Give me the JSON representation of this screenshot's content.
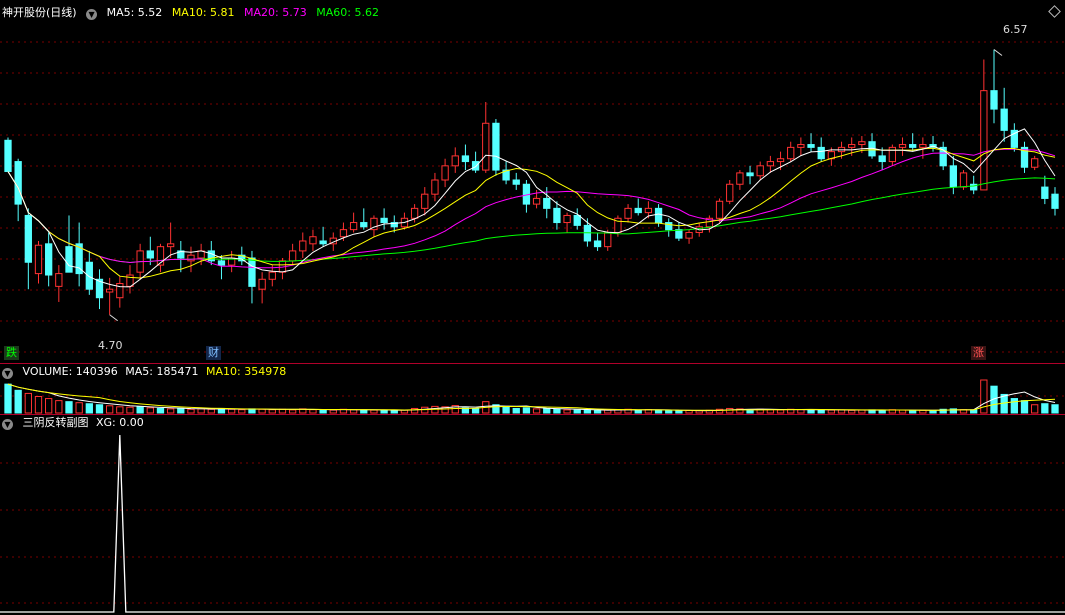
{
  "header": {
    "stock_name": "神开股份(日线)",
    "ma": [
      {
        "label": "MA5: 5.52",
        "color": "#ffffff"
      },
      {
        "label": "MA10: 5.81",
        "color": "#ffff00"
      },
      {
        "label": "MA20: 5.73",
        "color": "#ff00ff"
      },
      {
        "label": "MA60: 5.62",
        "color": "#00ff00"
      }
    ]
  },
  "price_pane": {
    "high_label": "6.57",
    "low_label": "4.70",
    "markers": [
      {
        "text": "跌",
        "color": "#00ff00"
      },
      {
        "text": "财",
        "color": "#4aa8ff"
      },
      {
        "text": "涨",
        "color": "#ff4040"
      }
    ]
  },
  "volume_pane": {
    "title": "VOLUME: 140396",
    "ma5": "MA5: 185471",
    "ma10": "MA10: 354978"
  },
  "indicator_pane": {
    "title": "三阴反转副图",
    "xg": "XG: 0.00"
  },
  "colors": {
    "up": "#ff3232",
    "down": "#54ffff",
    "grid": "#7a0000",
    "divider": "#b0002a"
  },
  "chart_data": {
    "type": "candlestick",
    "price_range": [
      4.55,
      6.75
    ],
    "highest": 6.57,
    "lowest": 4.7,
    "candles": [
      [
        5.93,
        5.95,
        5.93,
        5.71
      ],
      [
        5.78,
        5.8,
        5.36,
        5.48
      ],
      [
        5.4,
        5.45,
        4.88,
        5.07
      ],
      [
        4.99,
        5.22,
        4.92,
        5.19
      ],
      [
        5.2,
        5.28,
        4.9,
        4.98
      ],
      [
        4.9,
        5.05,
        4.79,
        4.99
      ],
      [
        5.18,
        5.4,
        5.0,
        5.0
      ],
      [
        5.2,
        5.35,
        4.9,
        4.99
      ],
      [
        5.07,
        5.15,
        4.84,
        4.88
      ],
      [
        4.95,
        5.02,
        4.74,
        4.82
      ],
      [
        4.86,
        4.96,
        4.7,
        4.88
      ],
      [
        4.82,
        4.97,
        4.75,
        4.92
      ],
      [
        4.9,
        5.05,
        4.85,
        4.98
      ],
      [
        5.0,
        5.2,
        4.95,
        5.15
      ],
      [
        5.15,
        5.25,
        5.05,
        5.1
      ],
      [
        5.05,
        5.2,
        5.0,
        5.18
      ],
      [
        5.18,
        5.35,
        5.1,
        5.2
      ],
      [
        5.15,
        5.22,
        5.0,
        5.1
      ],
      [
        5.08,
        5.18,
        5.0,
        5.12
      ],
      [
        5.1,
        5.2,
        5.05,
        5.15
      ],
      [
        5.15,
        5.22,
        5.05,
        5.08
      ],
      [
        5.08,
        5.12,
        4.95,
        5.05
      ],
      [
        5.05,
        5.15,
        5.0,
        5.1
      ],
      [
        5.12,
        5.18,
        5.05,
        5.08
      ],
      [
        5.1,
        5.15,
        4.78,
        4.9
      ],
      [
        4.88,
        5.0,
        4.78,
        4.95
      ],
      [
        4.95,
        5.05,
        4.9,
        5.0
      ],
      [
        5.0,
        5.1,
        4.95,
        5.08
      ],
      [
        5.08,
        5.2,
        5.05,
        5.15
      ],
      [
        5.15,
        5.28,
        5.1,
        5.22
      ],
      [
        5.2,
        5.3,
        5.15,
        5.25
      ],
      [
        5.22,
        5.32,
        5.18,
        5.2
      ],
      [
        5.2,
        5.28,
        5.15,
        5.24
      ],
      [
        5.25,
        5.35,
        5.22,
        5.3
      ],
      [
        5.3,
        5.42,
        5.28,
        5.35
      ],
      [
        5.35,
        5.45,
        5.3,
        5.32
      ],
      [
        5.3,
        5.4,
        5.25,
        5.38
      ],
      [
        5.38,
        5.45,
        5.3,
        5.35
      ],
      [
        5.35,
        5.4,
        5.28,
        5.32
      ],
      [
        5.32,
        5.42,
        5.3,
        5.38
      ],
      [
        5.38,
        5.48,
        5.35,
        5.45
      ],
      [
        5.45,
        5.6,
        5.4,
        5.55
      ],
      [
        5.55,
        5.7,
        5.5,
        5.65
      ],
      [
        5.65,
        5.8,
        5.6,
        5.75
      ],
      [
        5.75,
        5.88,
        5.7,
        5.82
      ],
      [
        5.82,
        5.9,
        5.72,
        5.78
      ],
      [
        5.78,
        5.85,
        5.7,
        5.72
      ],
      [
        5.72,
        6.2,
        5.7,
        6.05
      ],
      [
        6.05,
        6.08,
        5.68,
        5.72
      ],
      [
        5.72,
        5.78,
        5.62,
        5.65
      ],
      [
        5.65,
        5.7,
        5.58,
        5.62
      ],
      [
        5.62,
        5.65,
        5.42,
        5.48
      ],
      [
        5.48,
        5.58,
        5.45,
        5.52
      ],
      [
        5.52,
        5.6,
        5.38,
        5.45
      ],
      [
        5.45,
        5.5,
        5.3,
        5.35
      ],
      [
        5.35,
        5.42,
        5.28,
        5.4
      ],
      [
        5.4,
        5.45,
        5.3,
        5.33
      ],
      [
        5.33,
        5.38,
        5.18,
        5.22
      ],
      [
        5.22,
        5.28,
        5.15,
        5.18
      ],
      [
        5.18,
        5.3,
        5.15,
        5.28
      ],
      [
        5.28,
        5.4,
        5.25,
        5.38
      ],
      [
        5.38,
        5.48,
        5.35,
        5.45
      ],
      [
        5.45,
        5.52,
        5.4,
        5.42
      ],
      [
        5.42,
        5.5,
        5.38,
        5.45
      ],
      [
        5.45,
        5.48,
        5.32,
        5.35
      ],
      [
        5.35,
        5.38,
        5.25,
        5.3
      ],
      [
        5.3,
        5.35,
        5.22,
        5.24
      ],
      [
        5.24,
        5.3,
        5.2,
        5.28
      ],
      [
        5.28,
        5.35,
        5.25,
        5.32
      ],
      [
        5.32,
        5.4,
        5.28,
        5.38
      ],
      [
        5.38,
        5.52,
        5.35,
        5.5
      ],
      [
        5.5,
        5.65,
        5.48,
        5.62
      ],
      [
        5.62,
        5.72,
        5.58,
        5.7
      ],
      [
        5.7,
        5.75,
        5.62,
        5.68
      ],
      [
        5.68,
        5.78,
        5.65,
        5.75
      ],
      [
        5.75,
        5.82,
        5.7,
        5.78
      ],
      [
        5.78,
        5.85,
        5.72,
        5.8
      ],
      [
        5.8,
        5.92,
        5.78,
        5.88
      ],
      [
        5.88,
        5.95,
        5.82,
        5.9
      ],
      [
        5.9,
        5.98,
        5.85,
        5.88
      ],
      [
        5.88,
        5.95,
        5.78,
        5.8
      ],
      [
        5.8,
        5.88,
        5.75,
        5.85
      ],
      [
        5.85,
        5.92,
        5.8,
        5.88
      ],
      [
        5.88,
        5.95,
        5.82,
        5.9
      ],
      [
        5.9,
        5.96,
        5.84,
        5.92
      ],
      [
        5.92,
        5.98,
        5.8,
        5.82
      ],
      [
        5.82,
        5.88,
        5.72,
        5.78
      ],
      [
        5.78,
        5.9,
        5.75,
        5.88
      ],
      [
        5.88,
        5.95,
        5.82,
        5.9
      ],
      [
        5.9,
        5.98,
        5.85,
        5.88
      ],
      [
        5.88,
        5.95,
        5.8,
        5.9
      ],
      [
        5.9,
        5.96,
        5.85,
        5.88
      ],
      [
        5.88,
        5.92,
        5.72,
        5.75
      ],
      [
        5.75,
        5.82,
        5.55,
        5.6
      ],
      [
        5.6,
        5.72,
        5.58,
        5.7
      ],
      [
        5.62,
        5.68,
        5.55,
        5.58
      ],
      [
        5.58,
        6.5,
        5.58,
        6.28
      ],
      [
        6.28,
        6.57,
        6.05,
        6.15
      ],
      [
        6.15,
        6.3,
        5.92,
        6.0
      ],
      [
        6.0,
        6.05,
        5.85,
        5.88
      ],
      [
        5.88,
        5.92,
        5.7,
        5.74
      ],
      [
        5.74,
        5.82,
        5.72,
        5.8
      ],
      [
        5.6,
        5.68,
        5.48,
        5.52
      ],
      [
        5.55,
        5.6,
        5.4,
        5.45
      ]
    ],
    "volume": [
      [
        140,
        0
      ],
      [
        110,
        0
      ],
      [
        95,
        1
      ],
      [
        80,
        1
      ],
      [
        70,
        1
      ],
      [
        60,
        1
      ],
      [
        55,
        0
      ],
      [
        50,
        1
      ],
      [
        45,
        0
      ],
      [
        40,
        0
      ],
      [
        35,
        1
      ],
      [
        30,
        1
      ],
      [
        28,
        1
      ],
      [
        30,
        0
      ],
      [
        25,
        1
      ],
      [
        22,
        0
      ],
      [
        20,
        1
      ],
      [
        22,
        0
      ],
      [
        18,
        1
      ],
      [
        20,
        1
      ],
      [
        18,
        1
      ],
      [
        22,
        0
      ],
      [
        18,
        1
      ],
      [
        16,
        1
      ],
      [
        20,
        0
      ],
      [
        18,
        1
      ],
      [
        16,
        1
      ],
      [
        18,
        1
      ],
      [
        15,
        1
      ],
      [
        20,
        1
      ],
      [
        16,
        1
      ],
      [
        15,
        0
      ],
      [
        14,
        1
      ],
      [
        18,
        1
      ],
      [
        16,
        1
      ],
      [
        15,
        0
      ],
      [
        14,
        1
      ],
      [
        13,
        0
      ],
      [
        12,
        0
      ],
      [
        14,
        1
      ],
      [
        22,
        1
      ],
      [
        28,
        1
      ],
      [
        32,
        1
      ],
      [
        30,
        1
      ],
      [
        36,
        1
      ],
      [
        24,
        0
      ],
      [
        20,
        0
      ],
      [
        55,
        1
      ],
      [
        40,
        0
      ],
      [
        28,
        0
      ],
      [
        22,
        0
      ],
      [
        25,
        0
      ],
      [
        20,
        1
      ],
      [
        22,
        0
      ],
      [
        18,
        0
      ],
      [
        15,
        1
      ],
      [
        14,
        0
      ],
      [
        16,
        0
      ],
      [
        12,
        0
      ],
      [
        14,
        1
      ],
      [
        16,
        1
      ],
      [
        18,
        1
      ],
      [
        14,
        0
      ],
      [
        16,
        1
      ],
      [
        14,
        0
      ],
      [
        12,
        0
      ],
      [
        10,
        0
      ],
      [
        12,
        1
      ],
      [
        11,
        1
      ],
      [
        13,
        1
      ],
      [
        18,
        1
      ],
      [
        22,
        1
      ],
      [
        20,
        1
      ],
      [
        16,
        0
      ],
      [
        18,
        1
      ],
      [
        16,
        1
      ],
      [
        15,
        1
      ],
      [
        18,
        1
      ],
      [
        16,
        1
      ],
      [
        14,
        0
      ],
      [
        16,
        0
      ],
      [
        14,
        1
      ],
      [
        15,
        1
      ],
      [
        13,
        1
      ],
      [
        14,
        1
      ],
      [
        15,
        0
      ],
      [
        14,
        0
      ],
      [
        16,
        1
      ],
      [
        14,
        1
      ],
      [
        12,
        0
      ],
      [
        13,
        1
      ],
      [
        12,
        0
      ],
      [
        18,
        0
      ],
      [
        20,
        0
      ],
      [
        16,
        1
      ],
      [
        15,
        0
      ],
      [
        160,
        1
      ],
      [
        130,
        0
      ],
      [
        90,
        0
      ],
      [
        70,
        0
      ],
      [
        60,
        0
      ],
      [
        40,
        1
      ],
      [
        45,
        0
      ],
      [
        40,
        0
      ]
    ],
    "xg": {
      "peak_index": 11,
      "peak_value": 1.0,
      "other_value": 0.0
    }
  }
}
